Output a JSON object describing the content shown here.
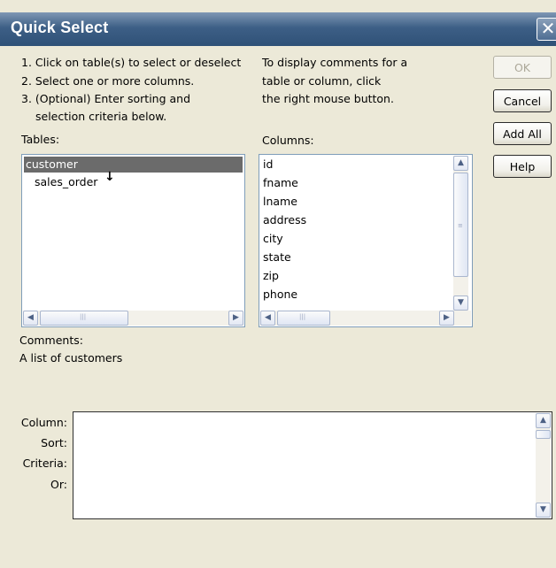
{
  "window": {
    "title": "Quick Select",
    "close_glyph": "✕"
  },
  "instructions": {
    "line1": "1. Click on table(s) to select or deselect",
    "line2": "2. Select one or more columns.",
    "line3": "3. (Optional) Enter sorting and",
    "line4": "selection criteria below."
  },
  "comment_hint": {
    "line1": "To display comments for a",
    "line2": "table or column, click",
    "line3": "the right mouse button."
  },
  "buttons": {
    "ok": "OK",
    "cancel": "Cancel",
    "add_all": "Add All",
    "help": "Help"
  },
  "tables": {
    "label": "Tables:",
    "items": [
      "customer",
      "sales_order"
    ],
    "selected": "customer",
    "cursor_glyph": "↓"
  },
  "columns": {
    "label": "Columns:",
    "items": [
      "id",
      "fname",
      "lname",
      "address",
      "city",
      "state",
      "zip",
      "phone"
    ]
  },
  "comments": {
    "label": "Comments:",
    "text": "A list of customers"
  },
  "criteria": {
    "column_label": "Column:",
    "sort_label": "Sort:",
    "criteria_label": "Criteria:",
    "or_label": "Or:"
  },
  "icons": {
    "scroll_left": "arrow-left-icon",
    "scroll_right": "arrow-right-icon",
    "scroll_up": "arrow-up-icon",
    "scroll_down": "arrow-down-icon"
  }
}
